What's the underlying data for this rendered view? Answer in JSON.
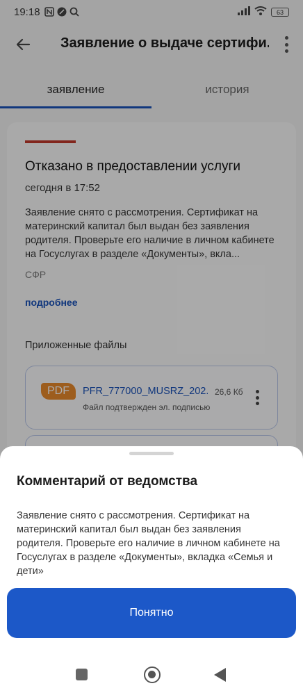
{
  "status_bar": {
    "time": "19:18",
    "battery": "63",
    "icons": [
      "nfc-icon",
      "app-icon",
      "search-icon",
      "signal-icon",
      "wifi-icon",
      "battery-icon"
    ]
  },
  "header": {
    "title": "Заявление о выдаче сертифи...",
    "back_icon": "arrow-left-icon",
    "more_icon": "more-vertical-icon"
  },
  "tabs": [
    {
      "label": "заявление",
      "active": true
    },
    {
      "label": "история",
      "active": false
    }
  ],
  "card": {
    "status_title": "Отказано в предоставлении услуги",
    "status_time": "сегодня в 17:52",
    "status_text": "Заявление снято с рассмотрения. Сертификат на материнский капитал был выдан без заявления родителя. Проверьте его наличие в личном кабинете на Госуслугах в разделе «Документы», вкла...",
    "org": "СФР",
    "more_link": "подробнее",
    "files_title": "Приложенные файлы",
    "file": {
      "type": "PDF",
      "name": "PFR_777000_MUSRZ_202...",
      "size": "26,6 Кб",
      "sign": "Файл подтвержден эл. подписью"
    }
  },
  "sheet": {
    "title": "Комментарий от ведомства",
    "text": "Заявление снято с рассмотрения. Сертификат на материнский капитал был выдан без заявления родителя. Проверьте его наличие в личном кабинете на Госуслугах в разделе «Документы», вкладка «Семья и дети»",
    "button": "Понятно"
  },
  "colors": {
    "accent": "#1c58c8",
    "link": "#1a52b8",
    "reject": "#c0392b",
    "pdf": "#e8892c"
  }
}
